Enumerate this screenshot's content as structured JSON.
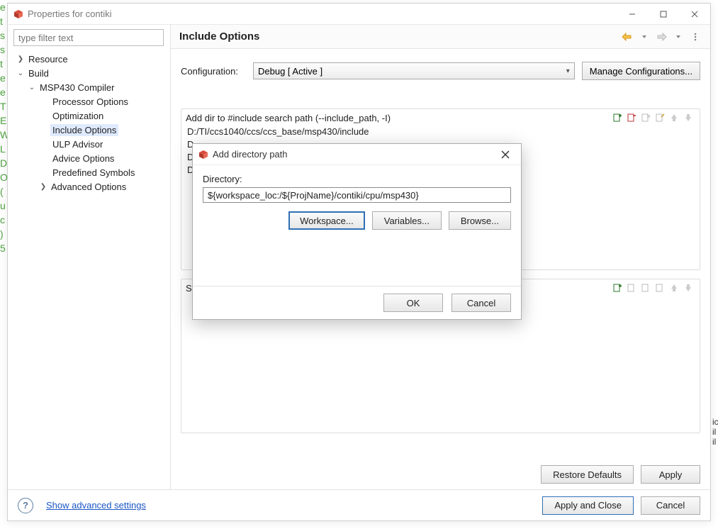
{
  "bg": {
    "left_glimpse": "e t s s t e e   T E W L D O ( u c ) 5",
    "right_glimpse": "ic il il"
  },
  "window": {
    "title": "Properties for contiki"
  },
  "filter": {
    "placeholder": "type filter text"
  },
  "tree": {
    "resource": "Resource",
    "build": "Build",
    "compiler": "MSP430 Compiler",
    "processor": "Processor Options",
    "optimization": "Optimization",
    "include": "Include Options",
    "ulp": "ULP Advisor",
    "advice": "Advice Options",
    "predef": "Predefined Symbols",
    "advanced": "Advanced Options"
  },
  "header": {
    "title": "Include Options"
  },
  "config": {
    "label": "Configuration:",
    "selected": "Debug  [ Active ]",
    "manage": "Manage Configurations..."
  },
  "group1": {
    "title": "Add dir to #include search path (--include_path, -I)",
    "items": [
      "D:/TI/ccs1040/ccs/ccs_base/msp430/include",
      "D",
      "D",
      "D"
    ]
  },
  "group2": {
    "title": "S"
  },
  "buttons": {
    "restore": "Restore Defaults",
    "apply": "Apply",
    "apply_close": "Apply and Close",
    "cancel": "Cancel"
  },
  "footer": {
    "advanced_link": "Show advanced settings"
  },
  "modal": {
    "title": "Add directory path",
    "dir_label": "Directory:",
    "dir_value": "${workspace_loc:/${ProjName}/contiki/cpu/msp430}",
    "workspace": "Workspace...",
    "variables": "Variables...",
    "browse": "Browse...",
    "ok": "OK",
    "cancel": "Cancel"
  }
}
